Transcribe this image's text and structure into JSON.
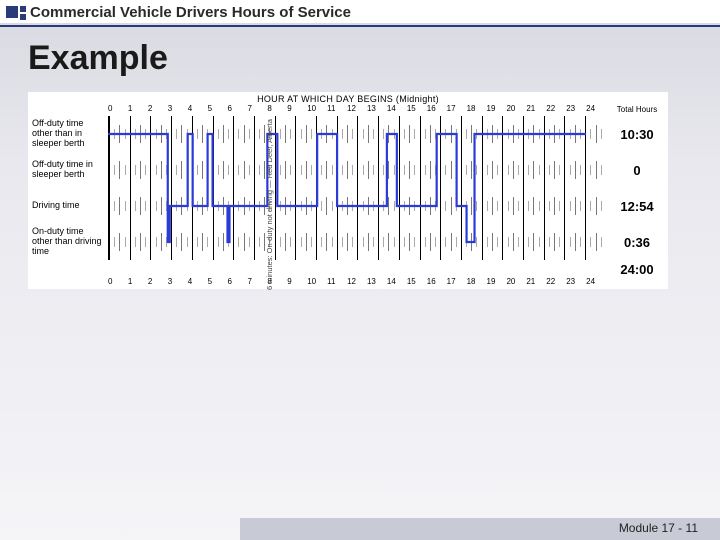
{
  "header": {
    "title": "Commercial Vehicle Drivers Hours of Service"
  },
  "heading": "Example",
  "chart_data": {
    "type": "timeline",
    "title": "HOUR AT WHICH DAY BEGINS (Midnight)",
    "hours": [
      "0",
      "1",
      "2",
      "3",
      "4",
      "5",
      "6",
      "7",
      "8",
      "9",
      "10",
      "11",
      "12",
      "13",
      "14",
      "15",
      "16",
      "17",
      "18",
      "19",
      "20",
      "21",
      "22",
      "23",
      "24"
    ],
    "right_header": "Total Hours",
    "rows": [
      {
        "label": "Off-duty time other than in sleeper berth",
        "total": "10:30"
      },
      {
        "label": "Off-duty time in sleeper berth",
        "total": "0"
      },
      {
        "label": "Driving time",
        "total": "12:54"
      },
      {
        "label": "On-duty time other than driving time",
        "total": "0:36"
      }
    ],
    "grand_total": "24:00",
    "status_timeline": [
      {
        "from": 0.0,
        "to": 3.0,
        "row": 0
      },
      {
        "from": 3.0,
        "to": 3.1,
        "row": 3
      },
      {
        "from": 3.1,
        "to": 4.0,
        "row": 2
      },
      {
        "from": 4.0,
        "to": 4.25,
        "row": 0
      },
      {
        "from": 4.25,
        "to": 5.0,
        "row": 2
      },
      {
        "from": 5.0,
        "to": 5.25,
        "row": 0
      },
      {
        "from": 5.25,
        "to": 6.0,
        "row": 2
      },
      {
        "from": 6.0,
        "to": 6.1,
        "row": 3
      },
      {
        "from": 6.1,
        "to": 8.0,
        "row": 2
      },
      {
        "from": 8.0,
        "to": 8.5,
        "row": 0
      },
      {
        "from": 8.5,
        "to": 10.5,
        "row": 2
      },
      {
        "from": 10.5,
        "to": 11.5,
        "row": 0
      },
      {
        "from": 11.5,
        "to": 14.0,
        "row": 2
      },
      {
        "from": 14.0,
        "to": 14.5,
        "row": 0
      },
      {
        "from": 14.5,
        "to": 16.5,
        "row": 2
      },
      {
        "from": 16.5,
        "to": 17.5,
        "row": 0
      },
      {
        "from": 17.5,
        "to": 18.0,
        "row": 2
      },
      {
        "from": 18.0,
        "to": 18.4,
        "row": 3
      },
      {
        "from": 18.4,
        "to": 24.0,
        "row": 0
      }
    ],
    "annotation": "6 minutes: On-duty not driving — Red Deer, Alberta"
  },
  "footer": {
    "module": "Module 17 -",
    "page": "11"
  }
}
